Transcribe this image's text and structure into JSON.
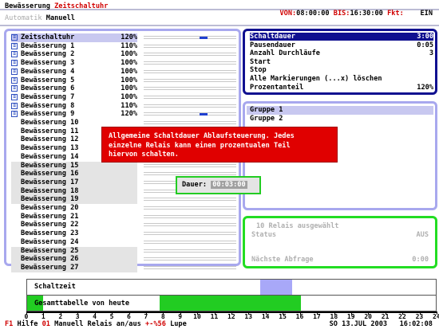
{
  "header": {
    "title": "Bewässerung",
    "mode": "Zeitschaltuhr",
    "von_label": "VON:",
    "von": "08:00:00",
    "bis_label": "BIS:",
    "bis": "16:30:00",
    "fkt_label": "Fkt:",
    "fkt": "EIN",
    "tab_auto": "Automatik",
    "tab_manual": "Manuell"
  },
  "relays": [
    {
      "name": "Zeitschaltuhr",
      "pct": "120%",
      "icon": true,
      "mark": true
    },
    {
      "name": "Bewässerung 1",
      "pct": "110%",
      "icon": true
    },
    {
      "name": "Bewässerung 2",
      "pct": "100%",
      "icon": true
    },
    {
      "name": "Bewässerung 3",
      "pct": "100%",
      "icon": true
    },
    {
      "name": "Bewässerung 4",
      "pct": "100%",
      "icon": true
    },
    {
      "name": "Bewässerung 5",
      "pct": "100%",
      "icon": true
    },
    {
      "name": "Bewässerung 6",
      "pct": "100%",
      "icon": true
    },
    {
      "name": "Bewässerung 7",
      "pct": "100%",
      "icon": true
    },
    {
      "name": "Bewässerung 8",
      "pct": "110%",
      "icon": true
    },
    {
      "name": "Bewässerung 9",
      "pct": "120%",
      "icon": true,
      "mark": true
    },
    {
      "name": "Bewässerung 10",
      "pct": ""
    },
    {
      "name": "Bewässerung 11",
      "pct": ""
    },
    {
      "name": "Bewässerung 12",
      "pct": ""
    },
    {
      "name": "Bewässerung 13",
      "pct": ""
    },
    {
      "name": "Bewässerung 14",
      "pct": ""
    },
    {
      "name": "Bewässerung 15",
      "pct": ""
    },
    {
      "name": "Bewässerung 16",
      "pct": ""
    },
    {
      "name": "Bewässerung 17",
      "pct": ""
    },
    {
      "name": "Bewässerung 18",
      "pct": ""
    },
    {
      "name": "Bewässerung 19",
      "pct": ""
    },
    {
      "name": "Bewässerung 20",
      "pct": ""
    },
    {
      "name": "Bewässerung 21",
      "pct": ""
    },
    {
      "name": "Bewässerung 22",
      "pct": ""
    },
    {
      "name": "Bewässerung 23",
      "pct": ""
    },
    {
      "name": "Bewässerung 24",
      "pct": ""
    },
    {
      "name": "Bewässerung 25",
      "pct": ""
    },
    {
      "name": "Bewässerung 26",
      "pct": ""
    },
    {
      "name": "Bewässerung 27",
      "pct": ""
    }
  ],
  "menu": [
    {
      "label": "Schaltdauer",
      "value": "3:00"
    },
    {
      "label": "Pausendauer",
      "value": "0:05"
    },
    {
      "label": "Anzahl Durchläufe",
      "value": "3"
    },
    {
      "label": "Start",
      "value": ""
    },
    {
      "label": "Stop",
      "value": ""
    },
    {
      "label": "Alle Markierungen (...x) löschen",
      "value": ""
    },
    {
      "label": "Prozentanteil",
      "value": "120%"
    }
  ],
  "groups": {
    "g1": "Gruppe 1",
    "g2": "Gruppe 2"
  },
  "info": {
    "selected": "10 Relais ausgewählt",
    "status_label": "Status",
    "status_value": "AUS",
    "next_label": "Nächste Abfrage",
    "next_value": "0:00"
  },
  "popup": {
    "text": "Allgemeine Schaltdauer Ablaufsteuerung. Jedes\neinzelne Relais kann einen prozentualen Teil\nhiervon schalten."
  },
  "dauer": {
    "label": "Dauer:",
    "value": "00:03:00"
  },
  "timeline": {
    "row1": "Schaltzeit",
    "row2": "Gesamttabelle von heute",
    "ticks": [
      "0",
      "1",
      "2",
      "3",
      "4",
      "5",
      "6",
      "7",
      "8",
      "9",
      "10",
      "11",
      "12",
      "13",
      "14",
      "15",
      "16",
      "17",
      "18",
      "19",
      "20",
      "21",
      "22",
      "23",
      "24"
    ]
  },
  "statusbar": {
    "k1": "F1",
    "t1": "Hilfe",
    "k2": "01",
    "t2": "Manuell Relais an/aus",
    "k3": "+-%56",
    "t3": "Lupe",
    "date": "SO 13.JUL 2003",
    "time": "16:02:08"
  },
  "colors": {
    "accent_red": "#d00000",
    "selection_blue": "#101090",
    "panel_lilac": "#a8a8ee",
    "green": "#22cc22"
  }
}
